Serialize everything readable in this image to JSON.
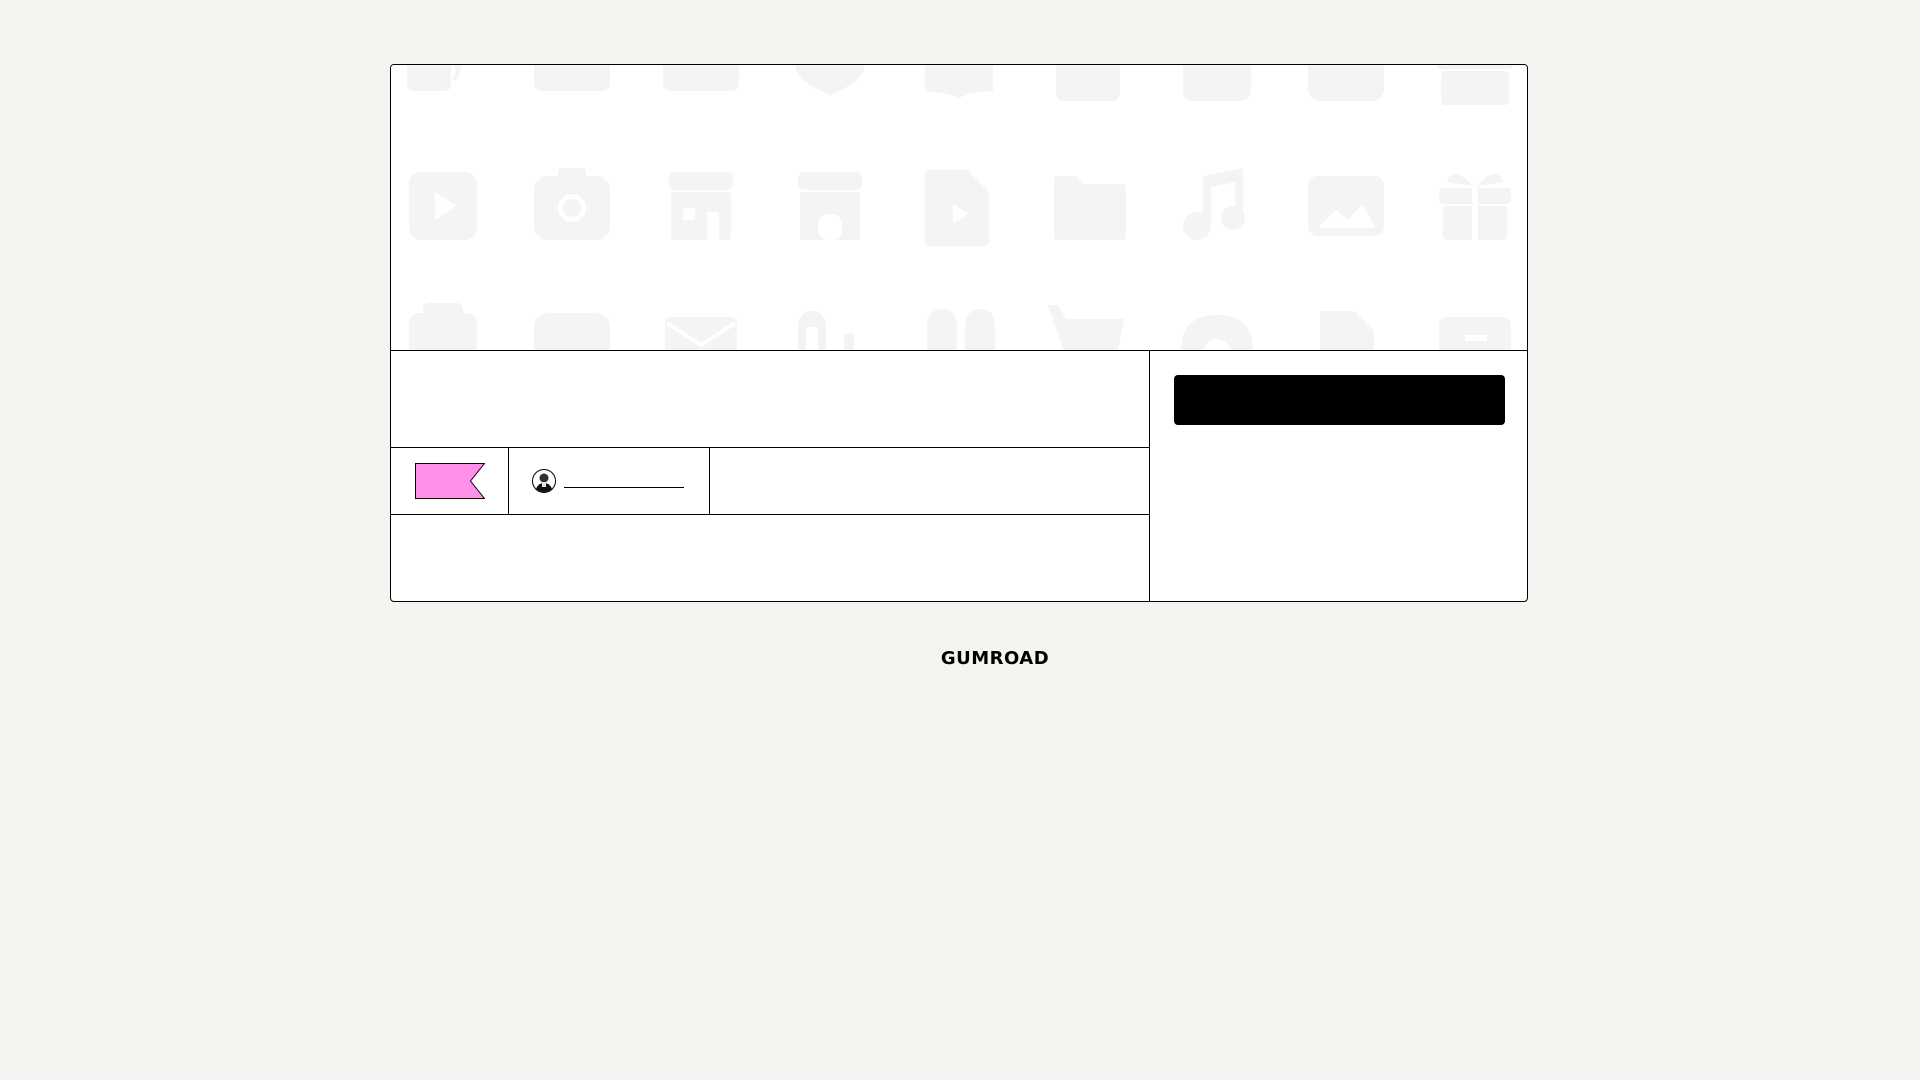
{
  "product": {
    "title": "",
    "price": "",
    "creator_name": "",
    "rating": "",
    "description": "",
    "cta_label": ""
  },
  "colors": {
    "page_background": "#f4f4f0",
    "card_background": "#ffffff",
    "price_tag": "#ff90e8",
    "cover_icons": "#f4f4f2",
    "button": "#000000"
  },
  "cover_icons": [
    [
      "megaphone-icon",
      "video-camera-icon",
      "mail-icon",
      "shield-icon",
      "book-icon",
      "newspaper-icon",
      "play-icon",
      "camera-icon",
      "gift-icon"
    ],
    [
      "play-icon",
      "camera-icon",
      "storefront-icon",
      "storefront-icon",
      "video-file-icon",
      "folder-icon",
      "music-note-icon",
      "image-icon",
      "gift-icon"
    ],
    [
      "photo-camera-icon",
      "gamepad-icon",
      "envelope-icon",
      "stats-bars-icon",
      "quote-icon",
      "shopping-cart-icon",
      "headphones-icon",
      "document-icon",
      "wallet-icon"
    ]
  ],
  "footer": {
    "logo_text": "GUMROAD"
  }
}
